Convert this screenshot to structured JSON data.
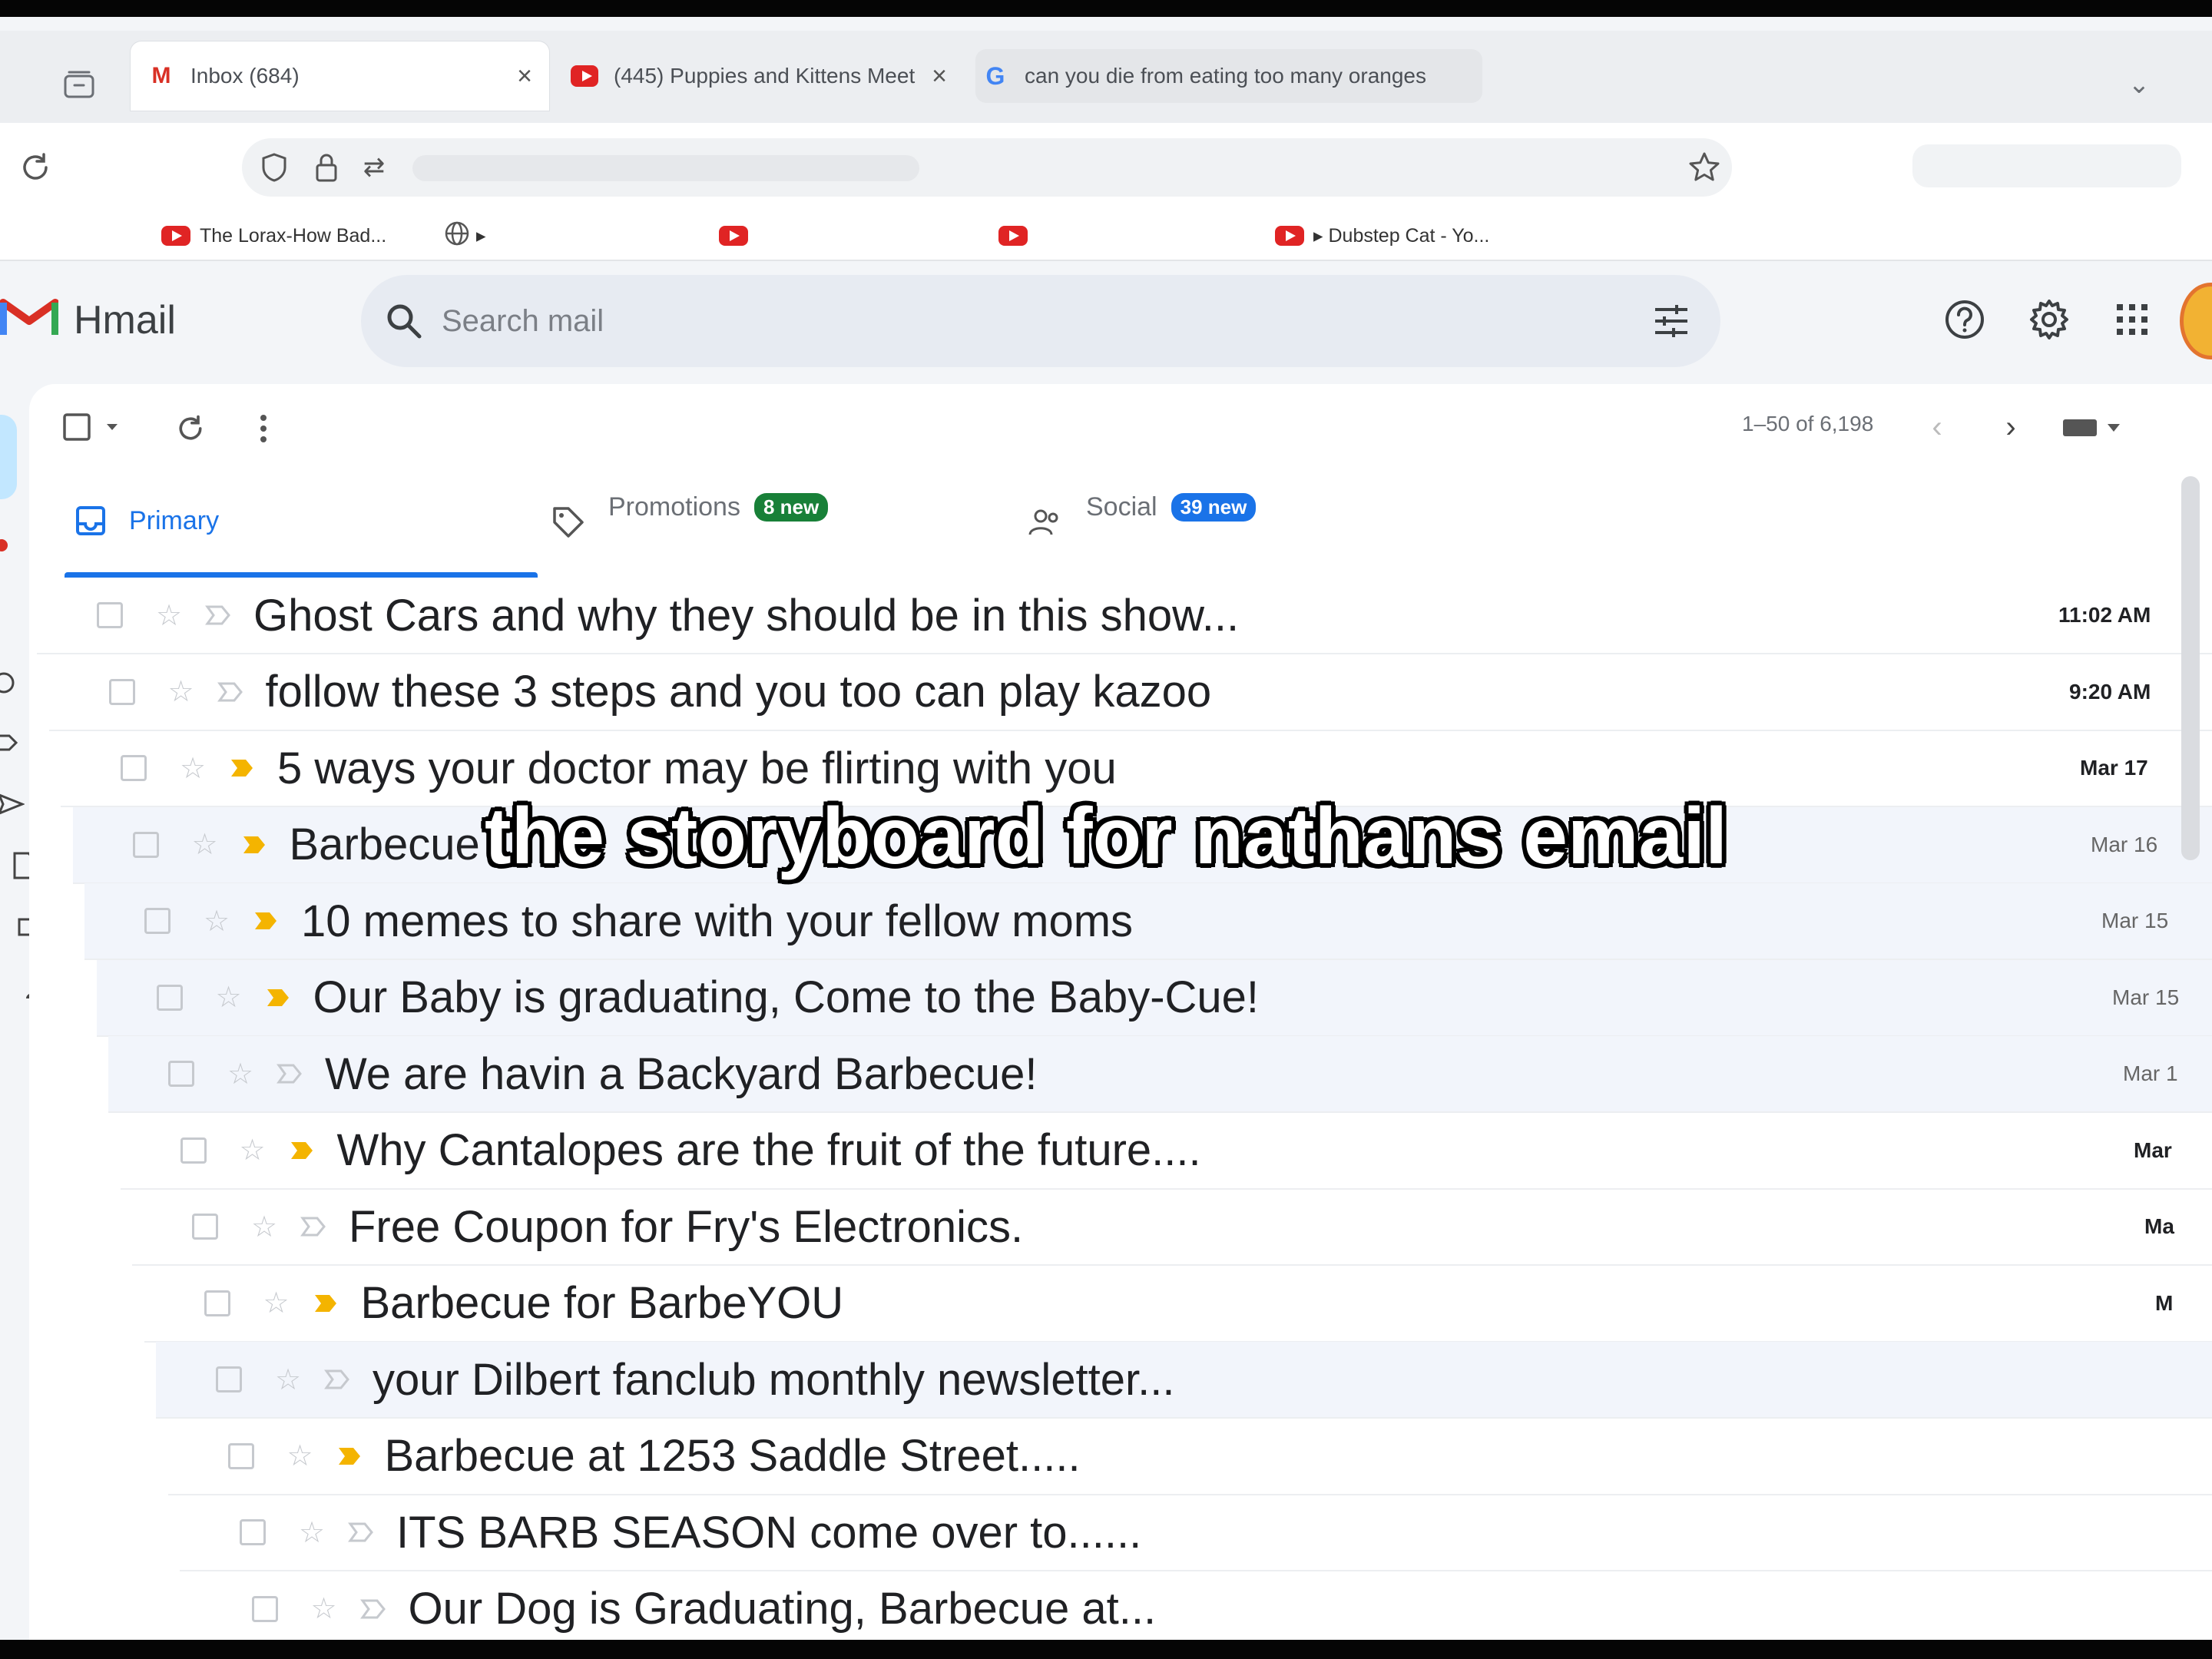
{
  "browser": {
    "tabs": [
      {
        "label": "Inbox (684)",
        "favicon": "gmail-icon",
        "active": true
      },
      {
        "label": "(445) Puppies and Kittens Meet",
        "favicon": "youtube-icon",
        "active": false
      },
      {
        "label": "can you die from eating too many oranges",
        "favicon": "google-icon",
        "active": false
      }
    ],
    "bookmarks": [
      {
        "label": "The Lorax-How Bad...",
        "favicon": "youtube-icon"
      },
      {
        "label": "▸",
        "favicon": "globe-icon"
      },
      {
        "label": "",
        "favicon": "youtube-icon"
      },
      {
        "label": "",
        "favicon": "youtube-icon"
      },
      {
        "label": "▸ Dubstep Cat - Yo...",
        "favicon": "youtube-icon"
      }
    ]
  },
  "gmail": {
    "app_name": "Hmail",
    "search_placeholder": "Search mail",
    "pager": "1–50 of 6,198",
    "categories": [
      {
        "label": "Primary",
        "badge": "",
        "active": true
      },
      {
        "label": "Promotions",
        "badge": "8 new",
        "badge_color": "#188038"
      },
      {
        "label": "Social",
        "badge": "39 new",
        "badge_color": "#1a73e8"
      }
    ],
    "emails": [
      {
        "subject": "Ghost Cars and why they should be in this show...",
        "date": "11:02 AM",
        "important": false,
        "read": false
      },
      {
        "subject": "follow these 3 steps and you too can play kazoo",
        "date": "9:20 AM",
        "important": false,
        "read": false
      },
      {
        "subject": "5 ways your doctor may be flirting with you",
        "date": "Mar 17",
        "important": true,
        "read": false
      },
      {
        "subject": "Barbecue",
        "date": "Mar 16",
        "important": true,
        "read": true
      },
      {
        "subject": "10 memes to share with your fellow moms",
        "date": "Mar 15",
        "important": true,
        "read": true
      },
      {
        "subject": "Our Baby is graduating, Come to the Baby-Cue!",
        "date": "Mar 15",
        "important": true,
        "read": true
      },
      {
        "subject": "We are havin a Backyard Barbecue!",
        "date": "Mar 1",
        "important": false,
        "read": true
      },
      {
        "subject": "Why Cantalopes are the fruit of the future....",
        "date": "Mar",
        "important": true,
        "read": false
      },
      {
        "subject": "Free Coupon for Fry's Electronics.",
        "date": "Ma",
        "important": false,
        "read": false
      },
      {
        "subject": "Barbecue for BarbeYOU",
        "date": "M",
        "important": true,
        "read": false
      },
      {
        "subject": "your Dilbert fanclub monthly newsletter...",
        "date": "",
        "important": false,
        "read": true
      },
      {
        "subject": "Barbecue at 1253 Saddle Street.....",
        "date": "",
        "important": true,
        "read": false
      },
      {
        "subject": "ITS BARB SEASON come over to......",
        "date": "",
        "important": false,
        "read": false
      },
      {
        "subject": "Our Dog is Graduating, Barbecue at...",
        "date": "",
        "important": false,
        "read": false
      }
    ]
  },
  "caption": "the storyboard for nathans email",
  "colors": {
    "accent": "#1a73e8",
    "important_marker": "#f4b400",
    "gmail_red": "#d93025"
  }
}
